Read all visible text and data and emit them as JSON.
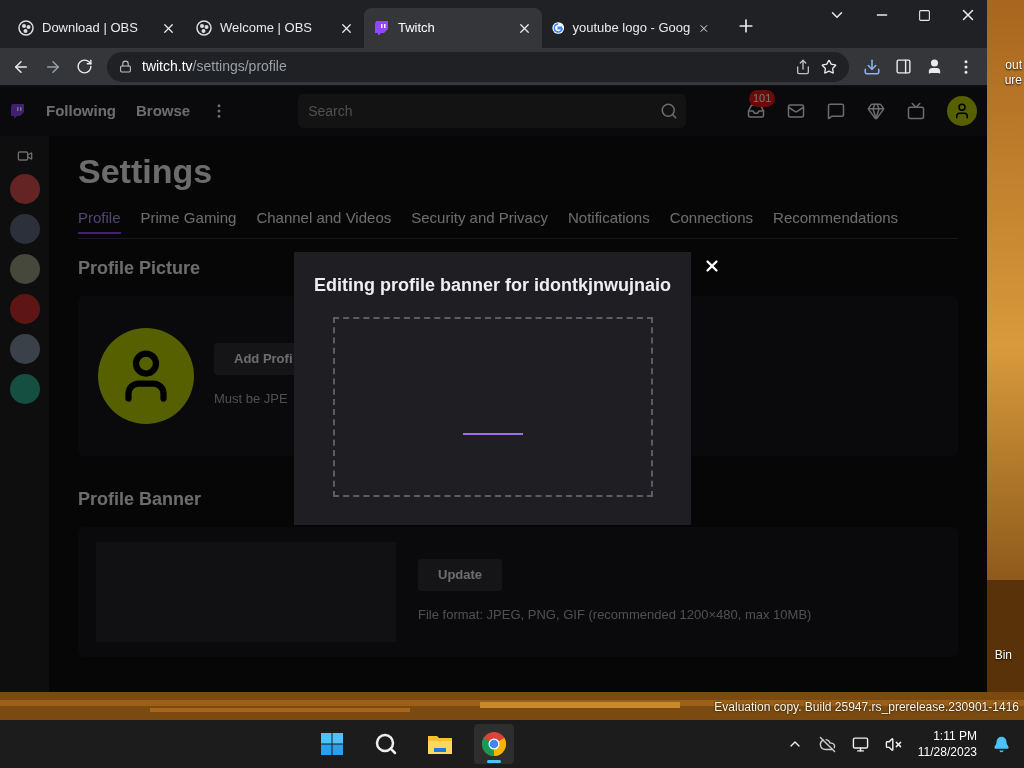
{
  "browser": {
    "tabs": [
      {
        "title": "Download | OBS",
        "selected": false
      },
      {
        "title": "Welcome | OBS",
        "selected": false
      },
      {
        "title": "Twitch",
        "selected": true
      },
      {
        "title": "youtube logo - Goog",
        "selected": false
      }
    ],
    "address": {
      "host": "twitch.tv",
      "path": "/settings/profile"
    }
  },
  "twitch": {
    "nav": {
      "links": [
        "Following",
        "Browse"
      ],
      "search_placeholder": "Search",
      "badge": "101"
    },
    "settings": {
      "title": "Settings",
      "tabs": [
        {
          "label": "Profile",
          "selected": true
        },
        {
          "label": "Prime Gaming",
          "selected": false
        },
        {
          "label": "Channel and Videos",
          "selected": false
        },
        {
          "label": "Security and Privacy",
          "selected": false
        },
        {
          "label": "Notifications",
          "selected": false
        },
        {
          "label": "Connections",
          "selected": false
        },
        {
          "label": "Recommendations",
          "selected": false
        }
      ],
      "profile_picture": {
        "heading": "Profile Picture",
        "button": "Add Profi",
        "hint": "Must be JPE"
      },
      "profile_banner": {
        "heading": "Profile Banner",
        "button": "Update",
        "hint": "File format: JPEG, PNG, GIF (recommended 1200×480, max 10MB)"
      }
    },
    "modal": {
      "title": "Editing profile banner for idontkjnwujnaio"
    }
  },
  "desktop": {
    "icon_labels": [
      "out",
      "ure",
      "Bin"
    ],
    "watermark": [
      "Evaluation copy. Build 25947.rs_prerelease.230901-1416"
    ]
  },
  "taskbar": {
    "apps": [
      {
        "kind": "start",
        "selected": false
      },
      {
        "kind": "search",
        "selected": false
      },
      {
        "kind": "explorer",
        "selected": false
      },
      {
        "kind": "chrome",
        "selected": true
      }
    ],
    "time": "1:11 PM",
    "date": "11/28/2023"
  }
}
